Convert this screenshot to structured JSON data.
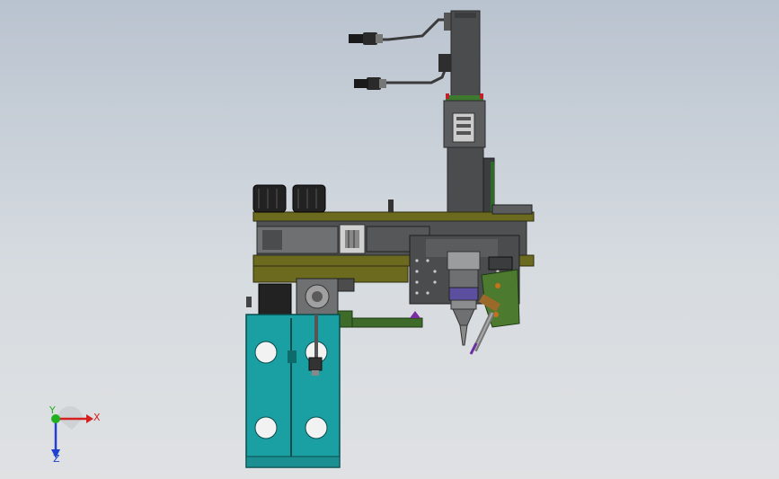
{
  "view": {
    "background_top": "#b9c3cf",
    "background_bottom": "#dfe1e3"
  },
  "model": {
    "colors": {
      "frame_olive": "#6b6a1e",
      "steel_dark": "#4a4c4e",
      "steel_mid": "#6e7072",
      "steel_light": "#9a9c9e",
      "base_teal": "#1aa0a2",
      "bracket_green": "#4c7a2e",
      "motor_black": "#222222",
      "accent_purple": "#6b2fa0",
      "accent_red": "#c0202a",
      "accent_orange": "#c8701a"
    }
  },
  "triad": {
    "x_label": "X",
    "y_label": "Y",
    "z_label": "Z",
    "x_color": "#d62020",
    "y_color": "#20b020",
    "z_color": "#2040d0"
  }
}
